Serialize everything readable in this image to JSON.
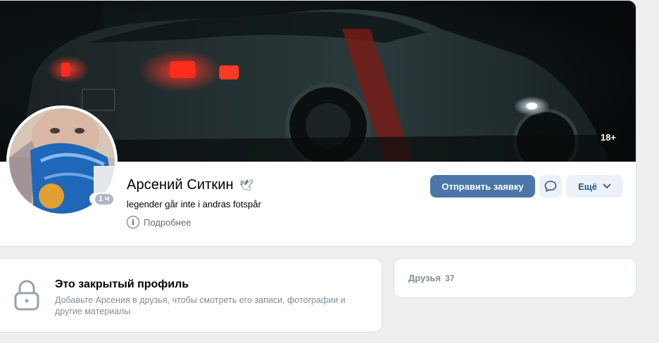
{
  "cover": {
    "age_badge": "18+"
  },
  "profile": {
    "name": "Арсений Ситкин",
    "name_emoji": "🕊",
    "status": "legender går inte i andras fotspår",
    "details_label": "Подробнее",
    "online": "1 ч",
    "actions": {
      "send_request": "Отправить заявку",
      "message_icon": "chat-bubble-icon",
      "more": "Ещё",
      "more_icon": "chevron-down-icon"
    }
  },
  "closed_profile": {
    "icon": "lock-icon",
    "title": "Это закрытый профиль",
    "text": "Добавьте Арсения в друзья, чтобы смотреть его записи, фотографии и другие материалы"
  },
  "friends": {
    "label": "Друзья",
    "count": "37"
  },
  "colors": {
    "page_bg": "#edeef0",
    "primary_button": "#4a76a8",
    "secondary_button": "#ecf1f7",
    "link": "#2a5885",
    "muted": "#818c99"
  }
}
